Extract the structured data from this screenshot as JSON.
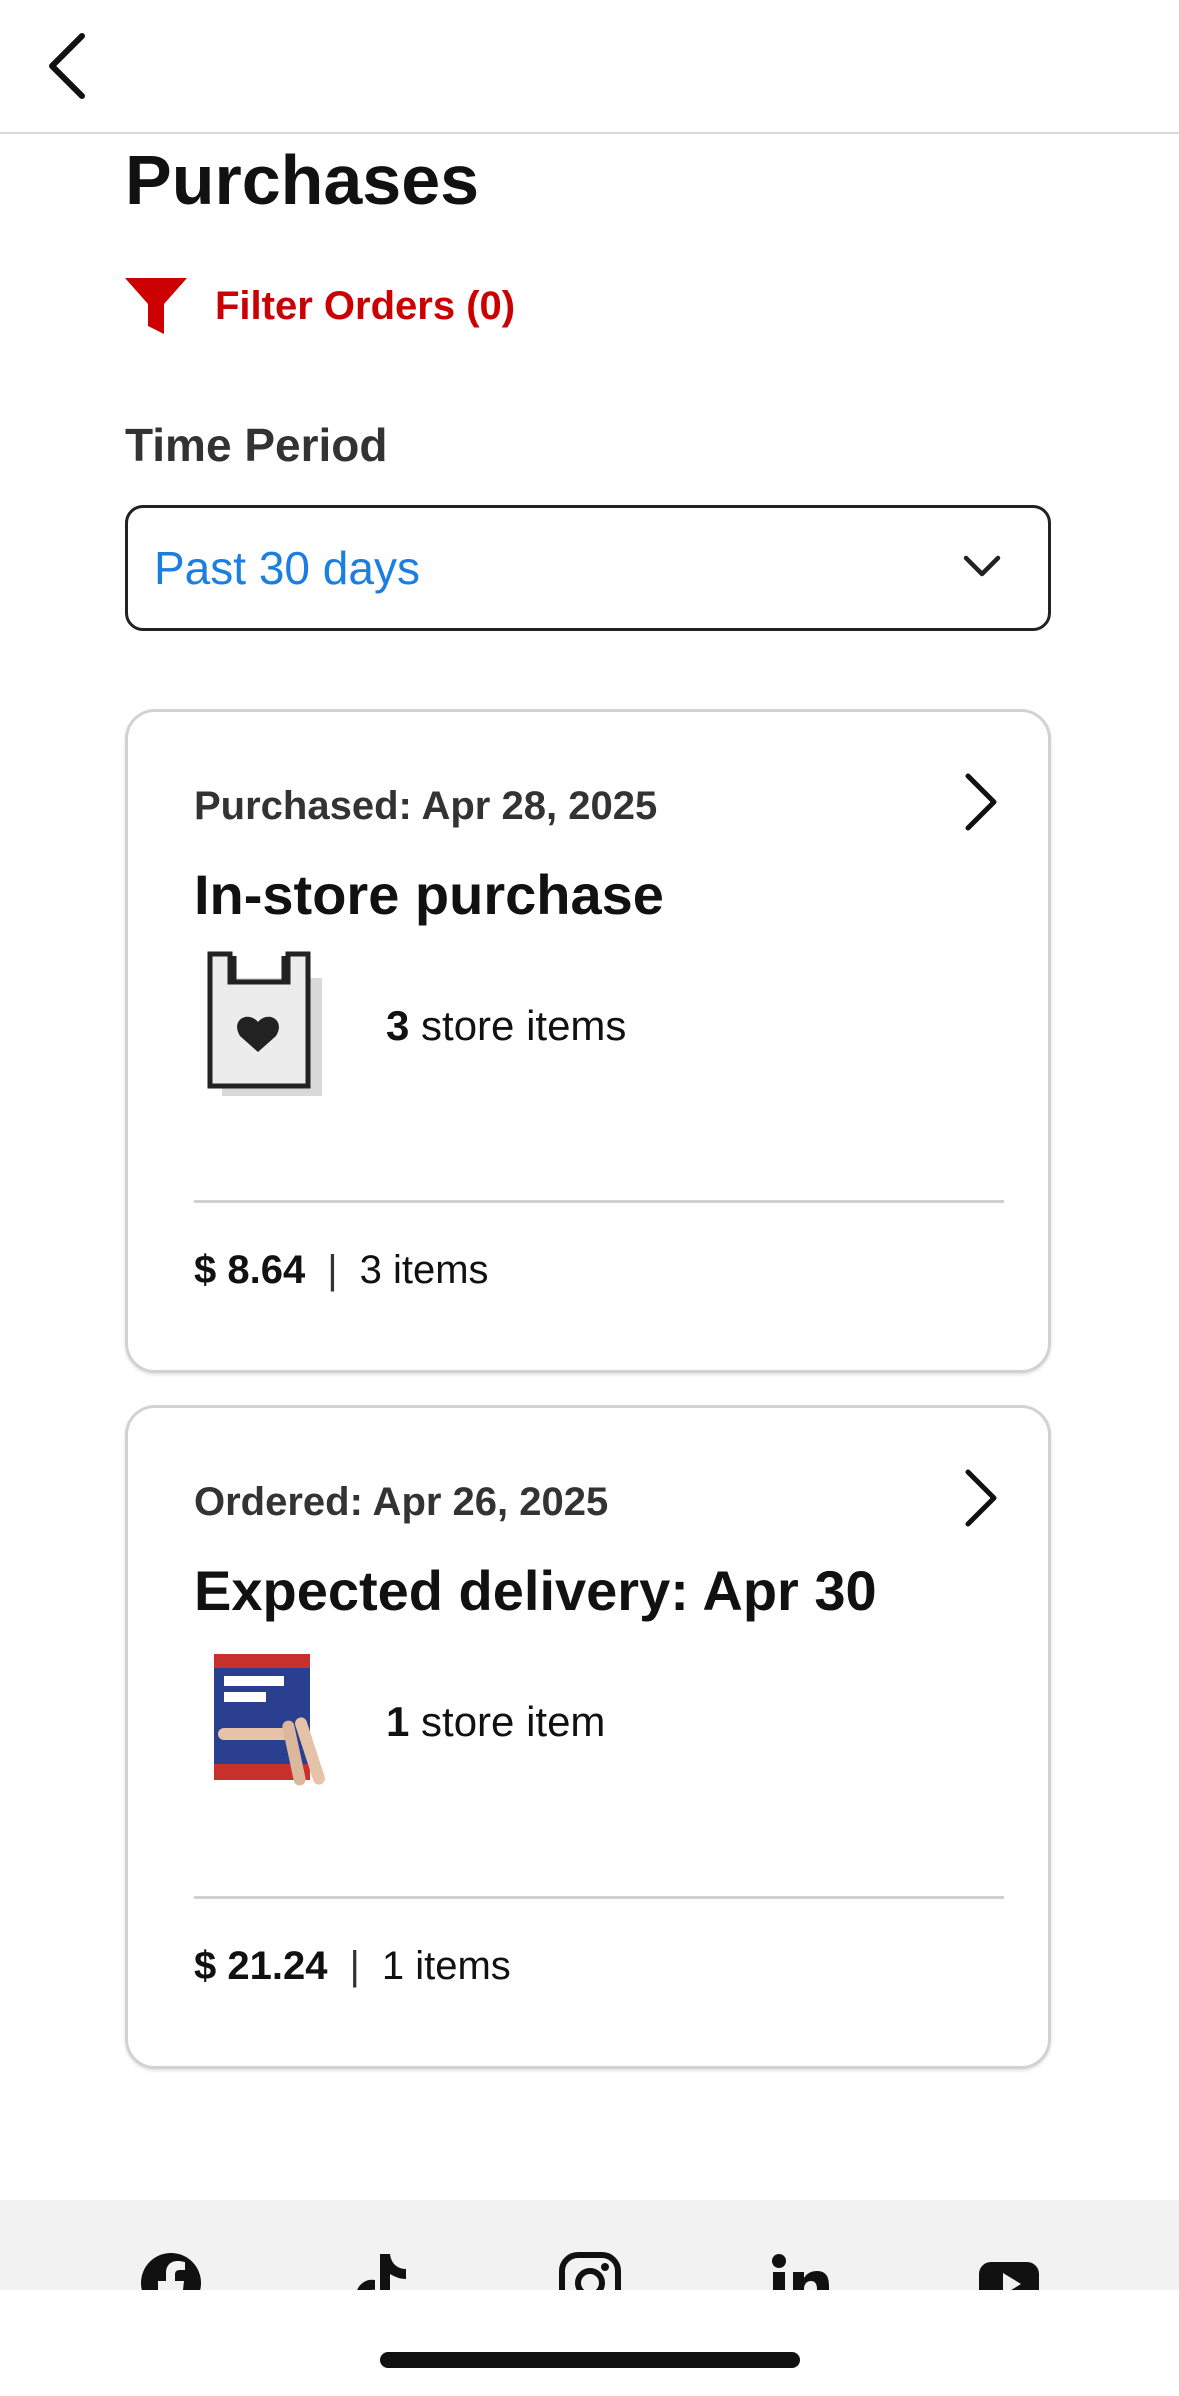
{
  "header": {
    "back_icon": "chevron-left-icon"
  },
  "page": {
    "title": "Purchases"
  },
  "filter": {
    "label": "Filter Orders (0)",
    "icon": "funnel-icon",
    "color": "#cc0000"
  },
  "time_period": {
    "label": "Time Period",
    "selected": "Past 30 days",
    "icon": "chevron-down-icon",
    "value_color": "#1a7fe0"
  },
  "orders": [
    {
      "date_label": "Purchased: Apr 28, 2025",
      "title": "In-store purchase",
      "thumb": "store-bag-icon",
      "item_count": "3",
      "item_count_label": "store items",
      "price": "$ 8.64",
      "separator": "|",
      "items_label": "3 items"
    },
    {
      "date_label": "Ordered: Apr 26, 2025",
      "title": "Expected delivery: Apr 30",
      "thumb": "breathe-right-product-image",
      "item_count": "1",
      "item_count_label": "store item",
      "price": "$ 21.24",
      "separator": "|",
      "items_label": "1 items"
    }
  ],
  "footer": {
    "social_icons": [
      "facebook-icon",
      "tiktok-icon",
      "instagram-icon",
      "linkedin-icon",
      "youtube-icon"
    ]
  }
}
